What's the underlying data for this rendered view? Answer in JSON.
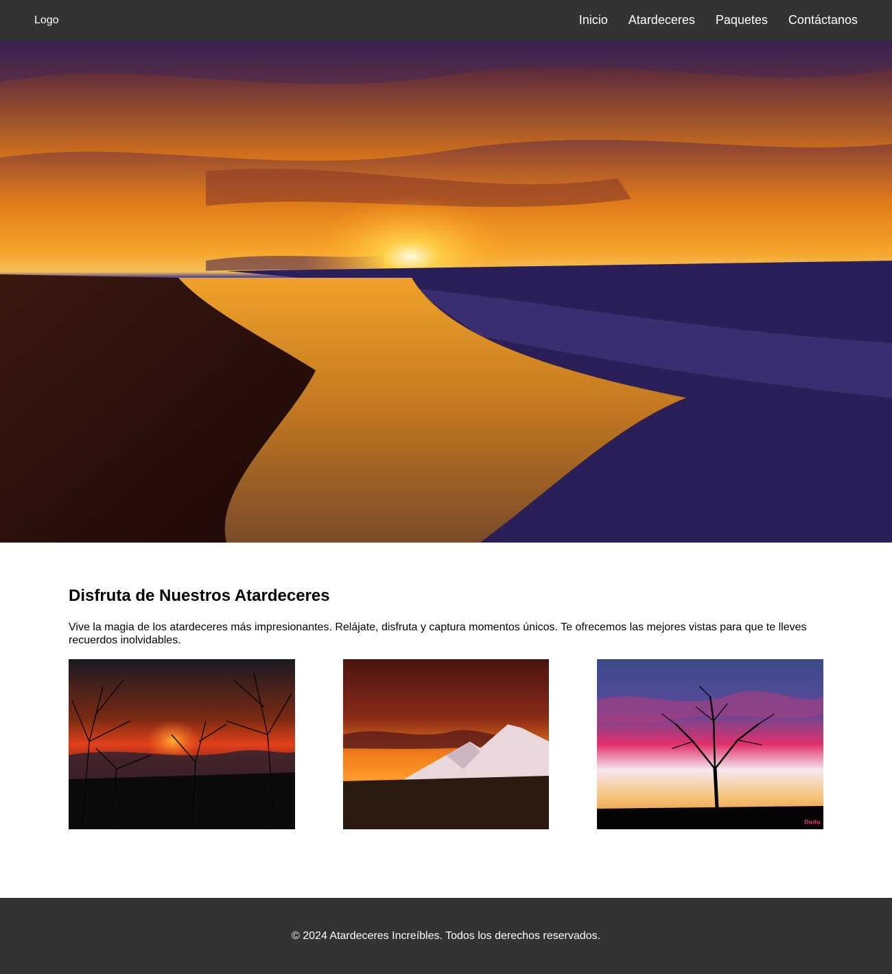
{
  "header": {
    "logo": "Logo",
    "nav": [
      "Inicio",
      "Atardeceres",
      "Paquetes",
      "Contáctanos"
    ]
  },
  "hero": {
    "image": "sunset-beach-image"
  },
  "main": {
    "heading": "Disfruta de Nuestros Atardeceres",
    "description": "Vive la magia de los atardeceres más impresionantes. Relájate, disfruta y captura momentos únicos. Te ofrecemos las mejores vistas para que te lleves recuerdos inolvidables.",
    "gallery": [
      {
        "image": "sunset-trees-silhouette-image"
      },
      {
        "image": "sunset-mountains-image"
      },
      {
        "image": "sunset-lone-tree-image",
        "watermark": "Dudu"
      }
    ]
  },
  "footer": {
    "copyright": "© 2024 Atardeceres Increíbles. Todos los derechos reservados."
  },
  "colors": {
    "header_bg": "#333333",
    "footer_bg": "#333333",
    "nav_text": "#ffffff",
    "watermark": "#d6336c"
  }
}
